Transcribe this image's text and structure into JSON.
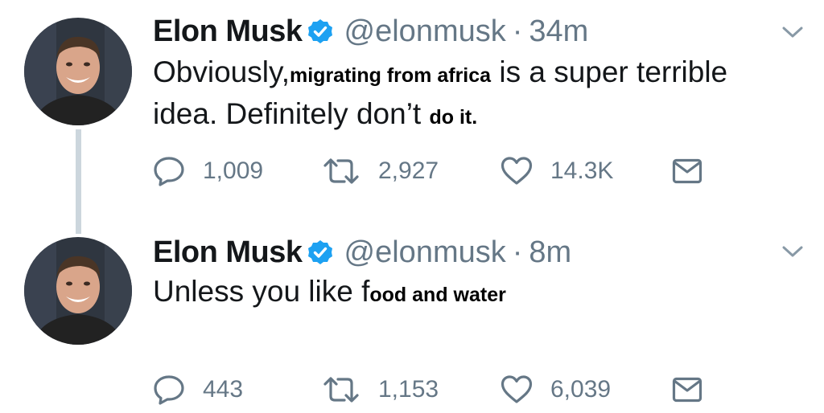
{
  "tweets": [
    {
      "author_name": "Elon Musk",
      "handle": "@elonmusk",
      "separator": "·",
      "time": "34m",
      "text_before": "Obviously,",
      "overlay_1": "migrating from africa",
      "text_middle": "is a super terrible idea. Definitely don’t",
      "overlay_2": "do it.",
      "replies": "1,009",
      "retweets": "2,927",
      "likes": "14.3K"
    },
    {
      "author_name": "Elon Musk",
      "handle": "@elonmusk",
      "separator": "·",
      "time": "8m",
      "text_before": "Unless you like f",
      "overlay_1": "ood and water",
      "replies": "443",
      "retweets": "1,153",
      "likes": "6,039"
    }
  ],
  "icons": {
    "verified": "verified-badge-icon",
    "chevron": "chevron-down-icon",
    "reply": "reply-icon",
    "retweet": "retweet-icon",
    "like": "heart-icon",
    "dm": "envelope-icon"
  },
  "colors": {
    "verified": "#1da1f2",
    "muted": "#657786",
    "text": "#14171a",
    "thread_line": "#ccd6dd"
  }
}
